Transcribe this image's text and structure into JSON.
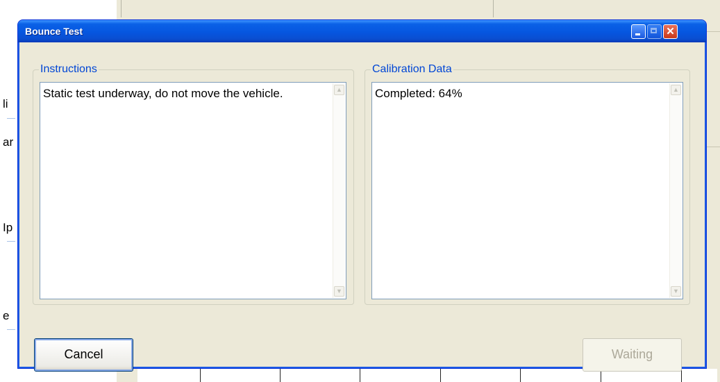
{
  "background": {
    "left_labels": [
      "li",
      "ar",
      "Ip",
      "e"
    ]
  },
  "dialog": {
    "title": "Bounce Test",
    "controls": {
      "minimize_icon": "minimize-icon",
      "maximize_icon": "maximize-icon",
      "close_icon": "close-icon",
      "close_glyph": "✕"
    },
    "instructions": {
      "legend": "Instructions",
      "text": "Static test underway, do not move the vehicle."
    },
    "calibration": {
      "legend": "Calibration Data",
      "text": "Completed: 64%",
      "progress_percent": 64
    },
    "buttons": {
      "cancel_label": "Cancel",
      "waiting_label": "Waiting"
    },
    "scroll_arrows": {
      "up": "▲",
      "down": "▼"
    }
  },
  "colors": {
    "titlebar": "#0a61e6",
    "legend_text": "#0046d5",
    "dialog_face": "#ece9d8"
  }
}
